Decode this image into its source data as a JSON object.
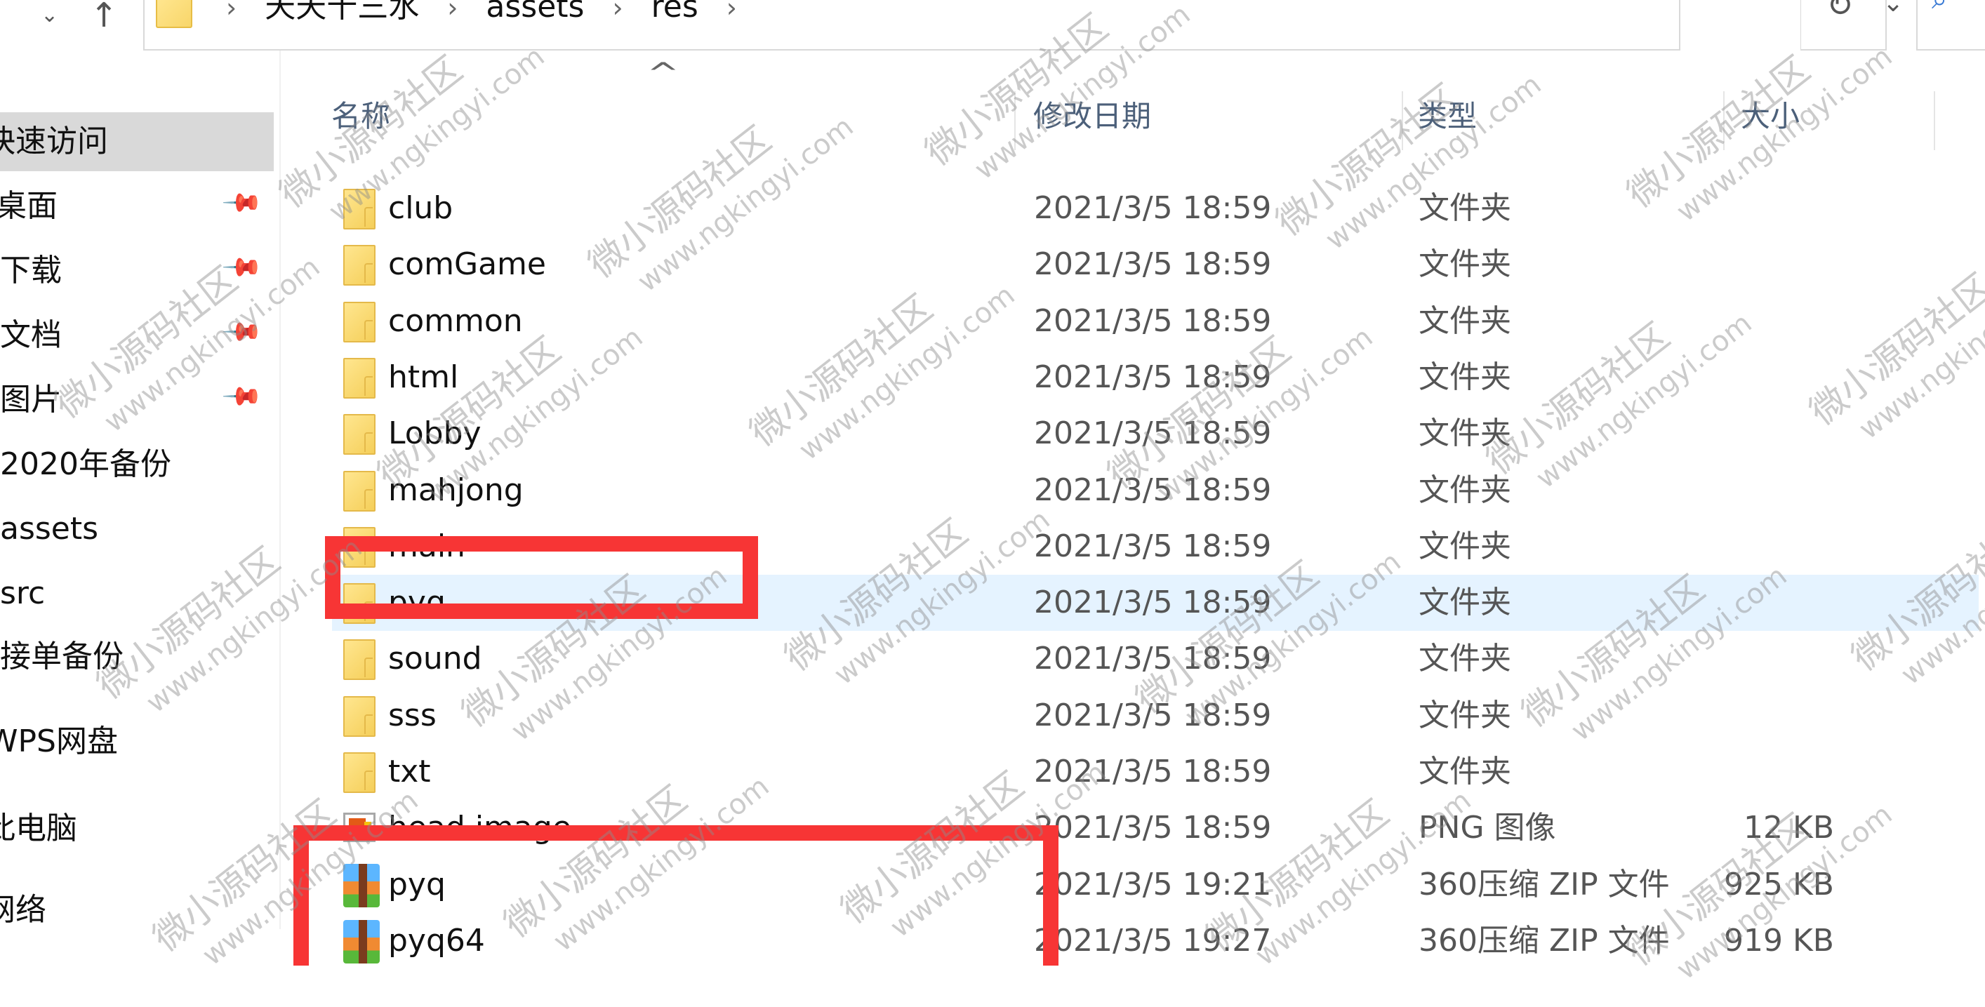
{
  "navbar": {
    "back_icon": "back-arrow-icon",
    "recent_icon": "chevron-down-icon",
    "up_icon": "up-arrow-icon",
    "breadcrumb": [
      "天天十三水",
      "assets",
      "res"
    ],
    "breadcrumb_separator": "›",
    "dropdown_icon": "chevron-down-icon",
    "refresh_icon": "refresh-icon",
    "search_icon": "search-icon"
  },
  "sidebar": {
    "items": [
      {
        "label": "快速访问",
        "active": true,
        "pinned": false
      },
      {
        "label": "桌面",
        "pinned": true
      },
      {
        "label": "下载",
        "pinned": true
      },
      {
        "label": "文档",
        "pinned": true
      },
      {
        "label": "图片",
        "pinned": true
      },
      {
        "label": "2020年备份",
        "pinned": false
      },
      {
        "label": "assets",
        "pinned": false
      },
      {
        "label": "src",
        "pinned": false
      },
      {
        "label": "接单备份",
        "pinned": false
      },
      {
        "label": "WPS网盘",
        "pinned": false
      },
      {
        "label": "此电脑",
        "pinned": false
      },
      {
        "label": "网络",
        "pinned": false
      }
    ]
  },
  "list": {
    "columns": {
      "name": "名称",
      "date": "修改日期",
      "type": "类型",
      "size": "大小"
    },
    "sort_indicator": "^",
    "rows": [
      {
        "name": "club",
        "date": "2021/3/5 18:59",
        "type": "文件夹",
        "size": "",
        "icon": "folder"
      },
      {
        "name": "comGame",
        "date": "2021/3/5 18:59",
        "type": "文件夹",
        "size": "",
        "icon": "folder"
      },
      {
        "name": "common",
        "date": "2021/3/5 18:59",
        "type": "文件夹",
        "size": "",
        "icon": "folder"
      },
      {
        "name": "html",
        "date": "2021/3/5 18:59",
        "type": "文件夹",
        "size": "",
        "icon": "folder"
      },
      {
        "name": "Lobby",
        "date": "2021/3/5 18:59",
        "type": "文件夹",
        "size": "",
        "icon": "folder"
      },
      {
        "name": "mahjong",
        "date": "2021/3/5 18:59",
        "type": "文件夹",
        "size": "",
        "icon": "folder"
      },
      {
        "name": "main",
        "date": "2021/3/5 18:59",
        "type": "文件夹",
        "size": "",
        "icon": "folder"
      },
      {
        "name": "pyq",
        "date": "2021/3/5 18:59",
        "type": "文件夹",
        "size": "",
        "icon": "folder",
        "selected": true
      },
      {
        "name": "sound",
        "date": "2021/3/5 18:59",
        "type": "文件夹",
        "size": "",
        "icon": "folder"
      },
      {
        "name": "sss",
        "date": "2021/3/5 18:59",
        "type": "文件夹",
        "size": "",
        "icon": "folder"
      },
      {
        "name": "txt",
        "date": "2021/3/5 18:59",
        "type": "文件夹",
        "size": "",
        "icon": "folder"
      },
      {
        "name": "head image",
        "date": "2021/3/5 18:59",
        "type": "PNG 图像",
        "size": "12 KB",
        "icon": "image"
      },
      {
        "name": "pyq",
        "date": "2021/3/5 19:21",
        "type": "360压缩 ZIP 文件",
        "size": "925 KB",
        "icon": "zip"
      },
      {
        "name": "pyq64",
        "date": "2021/3/5 19:27",
        "type": "360压缩 ZIP 文件",
        "size": "919 KB",
        "icon": "zip"
      }
    ]
  },
  "annotations": {
    "highlight_color": "#f73535",
    "selection_color": "#e5f3ff"
  },
  "watermark": {
    "text": "微小源码社区",
    "url": "www.ngkingyi.com"
  }
}
